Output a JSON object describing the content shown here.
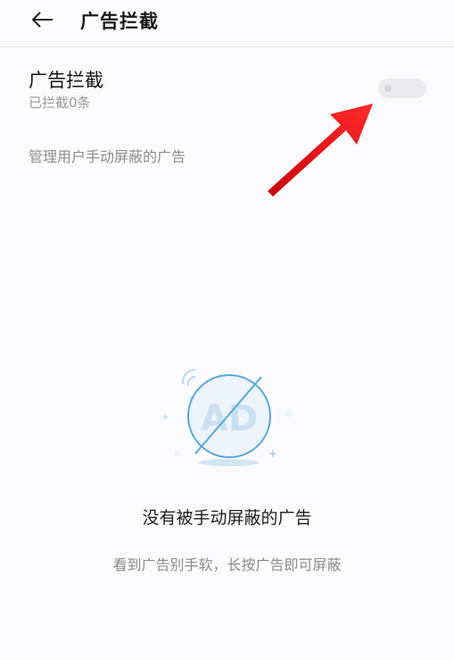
{
  "header": {
    "title": "广告拦截",
    "back_icon": "arrow-left-icon"
  },
  "setting": {
    "title": "广告拦截",
    "subtitle": "已拦截0条",
    "toggle_enabled": false
  },
  "manage": {
    "label": "管理用户手动屏蔽的广告"
  },
  "empty_state": {
    "illustration_text": "AD",
    "title": "没有被手动屏蔽的广告",
    "hint": "看到广告别手软，长按广告即可屏蔽",
    "icon": "ad-blocked-icon"
  },
  "colors": {
    "accent_blue": "#5aa6dc",
    "arrow_red": "#e8141c",
    "background": "#fbfbfe"
  }
}
